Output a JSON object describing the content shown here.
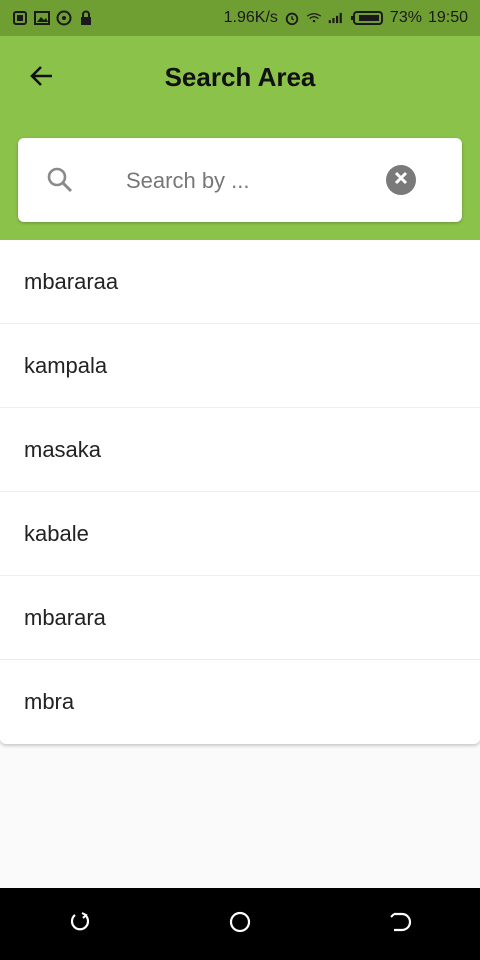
{
  "status_bar": {
    "net_speed": "1.96K/s",
    "battery": "73%",
    "time": "19:50",
    "icons": [
      "sim-icon",
      "image-icon",
      "whatsapp-icon",
      "lock-icon",
      "alarm-icon",
      "wifi-icon",
      "signal-icon",
      "battery-icon"
    ]
  },
  "header": {
    "title": "Search Area",
    "back_icon": "arrow-back-icon",
    "background": "#8bc34a"
  },
  "search": {
    "placeholder": "Search by ...",
    "value": "",
    "search_icon": "search-icon",
    "clear_icon": "clear-icon"
  },
  "results": [
    {
      "label": "mbararaa"
    },
    {
      "label": "kampala"
    },
    {
      "label": "masaka"
    },
    {
      "label": "kabale"
    },
    {
      "label": "mbarara"
    },
    {
      "label": "mbra"
    }
  ],
  "nav_bar": {
    "items": [
      "recents-icon",
      "home-icon",
      "back-nav-icon"
    ]
  }
}
